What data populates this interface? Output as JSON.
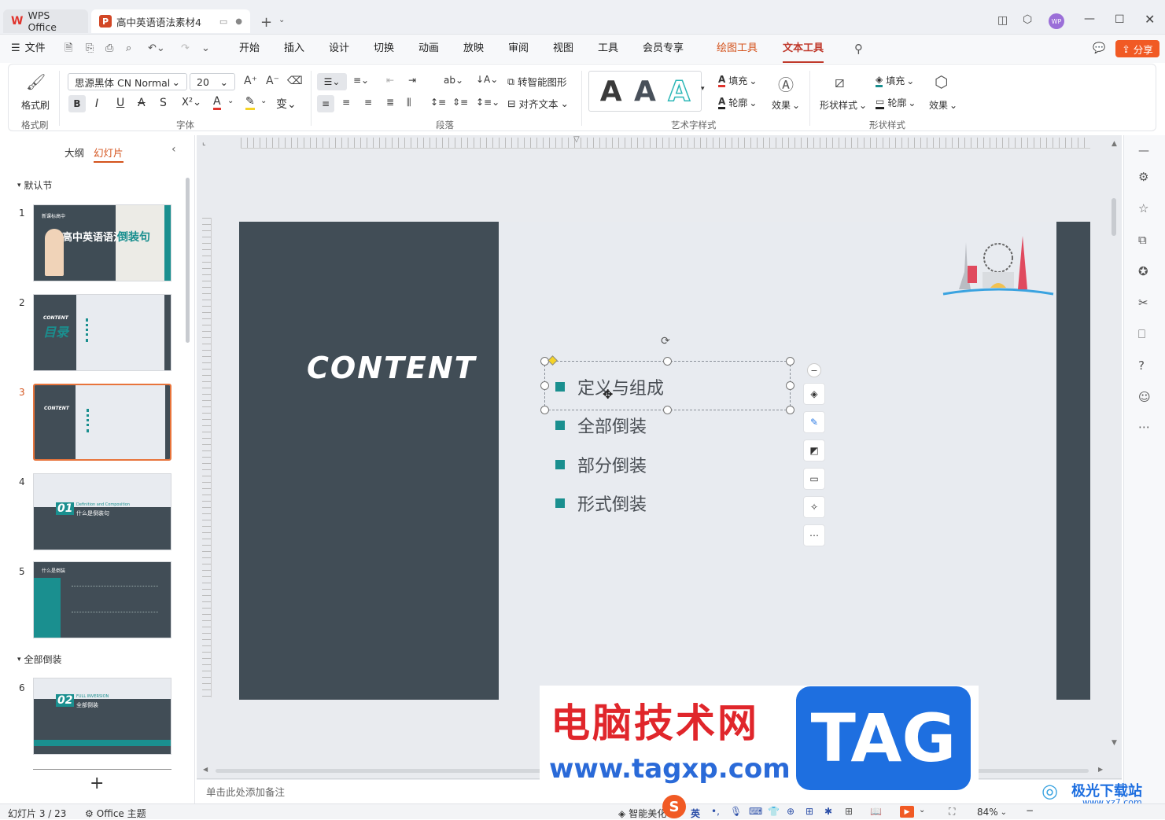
{
  "titlebar": {
    "home_tab": "WPS Office",
    "doc_tab": "高中英语语法素材4",
    "avatar": "WP"
  },
  "menubar": {
    "file": "文件",
    "items": [
      "开始",
      "插入",
      "设计",
      "切换",
      "动画",
      "放映",
      "审阅",
      "视图",
      "工具",
      "会员专享",
      "绘图工具",
      "文本工具"
    ],
    "share": "分享",
    "accent_drawing": "#d4531c",
    "accent_text": "#c0392b"
  },
  "ribbon": {
    "format_painter": "格式刷",
    "format_painter_group": "格式刷",
    "font_name": "思源黑体 CN Normal",
    "font_size": "20",
    "font_group": "字体",
    "para_group": "段落",
    "smart_shape": "转智能图形",
    "align_text": "对齐文本",
    "art_group": "艺术字样式",
    "fill": "填充",
    "outline": "轮廓",
    "effect": "效果",
    "shape_style": "形状样式",
    "shape_fill": "填充",
    "shape_outline": "轮廓",
    "shape_effect": "效果",
    "shape_group": "形状样式",
    "art_letter": "A"
  },
  "leftpanel": {
    "tab_outline": "大纲",
    "tab_slides": "幻灯片",
    "section_default": "默认节",
    "section_full": "全部倒装",
    "thumb1": {
      "title_small": "高中英语语法",
      "title_big": "倒装句",
      "num": "1",
      "tag": "新课标高中"
    },
    "thumb2": {
      "title": "CONTENT",
      "sub": "目录",
      "num": "2"
    },
    "thumb3": {
      "title": "CONTENT",
      "num": "3"
    },
    "thumb4": {
      "num": "4",
      "big": "01",
      "small": "Definition and Composition",
      "text": "什么是倒装句"
    },
    "thumb5": {
      "num": "5",
      "title": "什么是倒装"
    },
    "thumb6": {
      "num": "6",
      "big": "02",
      "small": "FULL INVERSION",
      "text": "全部倒装"
    },
    "add": "+"
  },
  "slide": {
    "content_title": "CONTENT",
    "items": [
      "定义与组成",
      "全部倒装",
      "部分倒装",
      "形式倒装"
    ],
    "teal": "#1a8f8f",
    "dark": "#414d56"
  },
  "notes_placeholder": "单击此处添加备注",
  "statusbar": {
    "slide_count": "幻灯片 3 / 23",
    "theme": "Office 主题",
    "smart": "智能美化",
    "ime": "英",
    "zoom": "84%"
  },
  "watermark": {
    "line1": "电脑技术网",
    "line2": "www.tagxp.com",
    "tag": "TAG",
    "site": "极光下载站",
    "url": "www.xz7.com"
  }
}
